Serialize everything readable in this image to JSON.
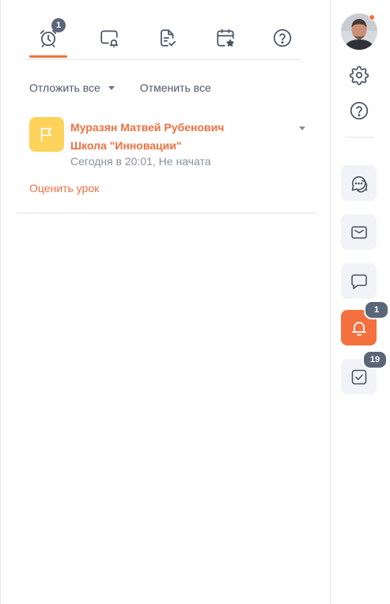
{
  "tabs": [
    {
      "name": "reminders",
      "icon": "alarm-clock-icon",
      "badge": "1",
      "active": true
    },
    {
      "name": "notifications",
      "icon": "screen-bell-icon"
    },
    {
      "name": "documents",
      "icon": "document-check-icon"
    },
    {
      "name": "calendar",
      "icon": "calendar-star-icon"
    },
    {
      "name": "help",
      "icon": "question-circle-icon"
    }
  ],
  "actions": {
    "postpone_all": "Отложить все",
    "cancel_all": "Отменить все"
  },
  "notification": {
    "icon": "flag-icon",
    "title_line1": "Муразян Матвей Рубенович",
    "title_line2": "Школа \"Инновации\"",
    "meta": "Сегодня в 20:01, Не начата",
    "link": "Оценить урок"
  },
  "rail": {
    "avatar": "user-avatar",
    "settings_icon": "gear-icon",
    "help_icon": "question-circle-icon",
    "buttons": [
      {
        "icon": "chat-bubbles-icon"
      },
      {
        "icon": "envelope-icon"
      },
      {
        "icon": "message-icon"
      },
      {
        "icon": "bell-icon",
        "badge": "1",
        "active": true
      },
      {
        "icon": "checkbox-icon",
        "badge": "19"
      }
    ]
  },
  "colors": {
    "accent": "#f4703e",
    "badge": "#5b6679",
    "icon": "#4a5363",
    "flag_bg": "#fdd35b"
  }
}
